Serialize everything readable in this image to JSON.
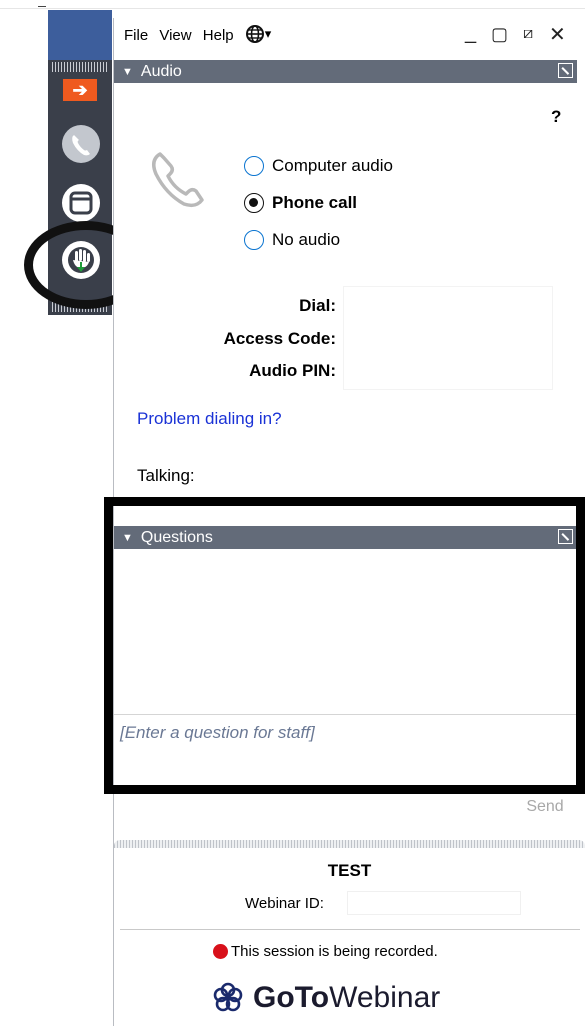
{
  "menu": {
    "file": "File",
    "view": "View",
    "help": "Help",
    "globe_icon": "globe-icon",
    "dropdown_caret": "▾"
  },
  "window_controls": {
    "minimize": "_",
    "restore": "▢",
    "maximize": "⧄",
    "close": "✕"
  },
  "audio": {
    "header": "Audio",
    "help_mark": "?",
    "options": [
      {
        "label": "Computer audio",
        "selected": false
      },
      {
        "label": "Phone call",
        "selected": true
      },
      {
        "label": "No audio",
        "selected": false
      }
    ],
    "dial_label": "Dial:",
    "access_code_label": "Access Code:",
    "audio_pin_label": "Audio PIN:",
    "problem_link": "Problem dialing in?",
    "talking_label": "Talking:"
  },
  "questions": {
    "header": "Questions",
    "placeholder": "[Enter a question for staff]",
    "send": "Send"
  },
  "footer": {
    "title": "TEST",
    "webinar_id_label": "Webinar ID:",
    "recording_notice": "This session is being recorded.",
    "brand_bold": "GoTo",
    "brand_light": "Webinar"
  },
  "colors": {
    "section_header": "#636b79",
    "accent_orange": "#ef5a1f",
    "link_blue": "#1a32d6",
    "record_red": "#d8101a",
    "strip_dark": "#3a3f4a"
  }
}
